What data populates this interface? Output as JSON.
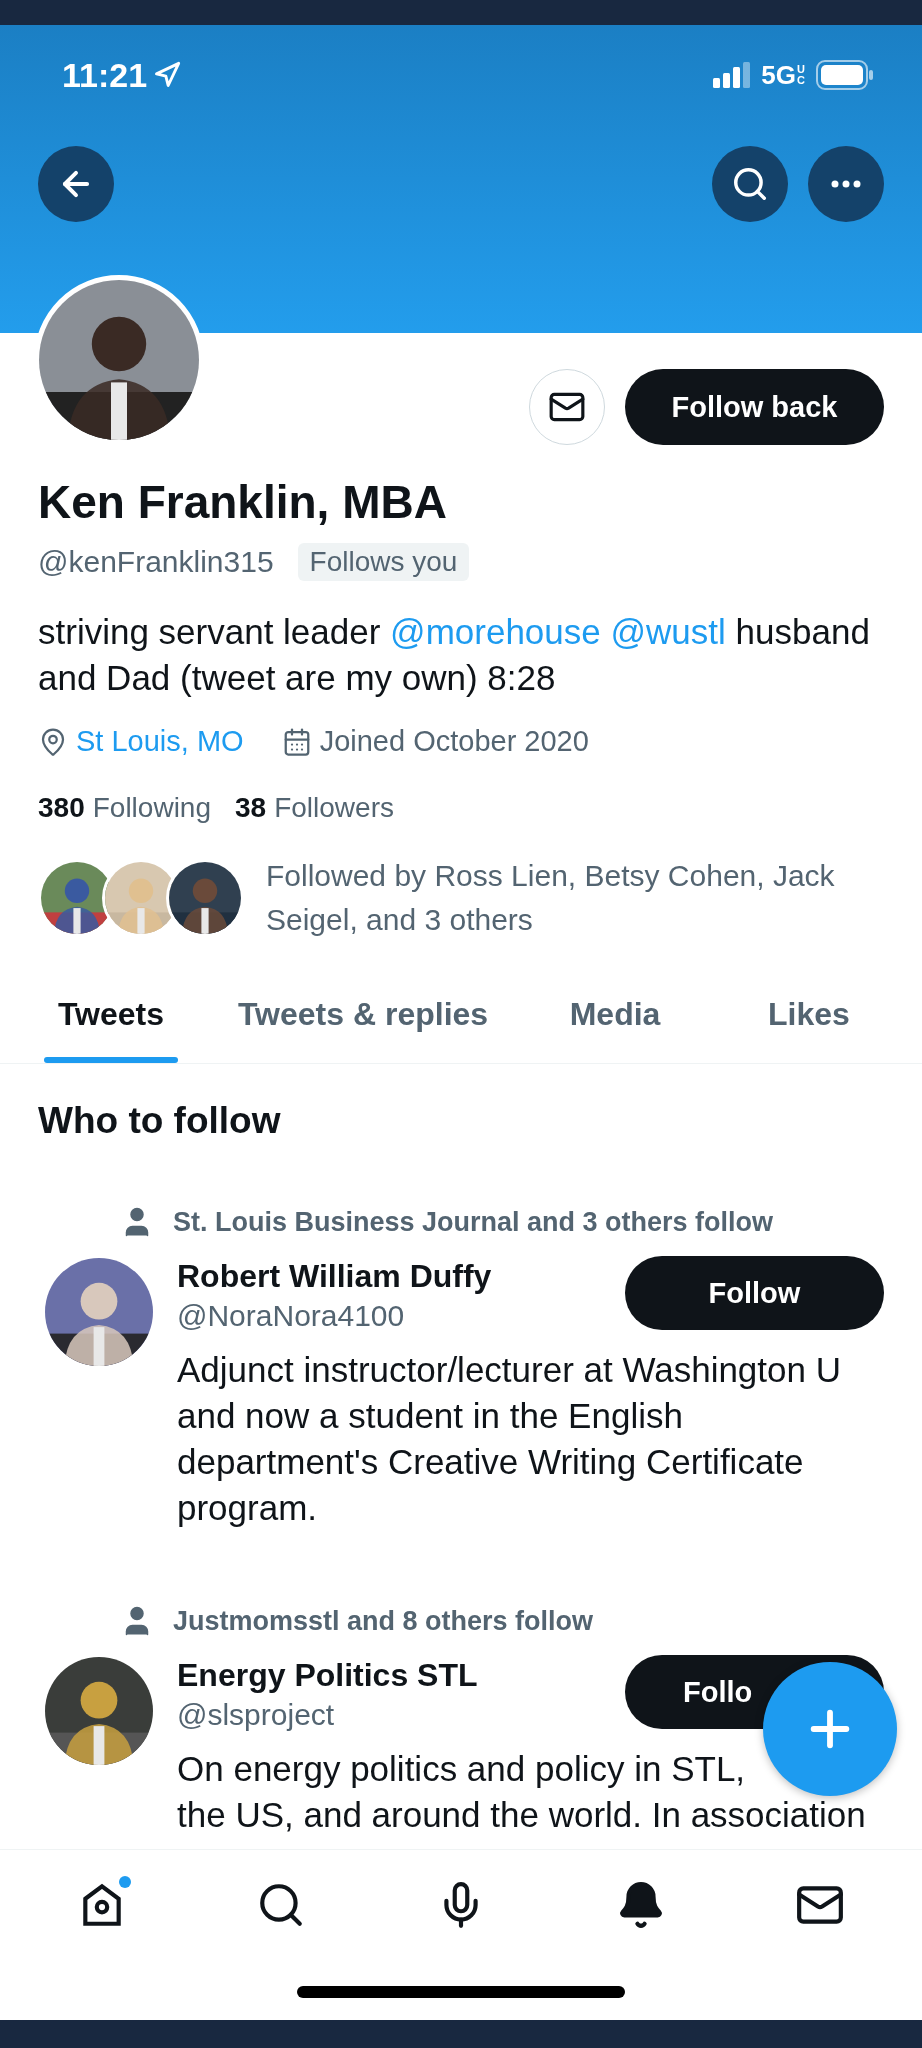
{
  "status_bar": {
    "time": "11:21",
    "network": "5G",
    "network_badge": "UC"
  },
  "profile": {
    "name": "Ken Franklin, MBA",
    "handle": "@kenFranklin315",
    "follows_you": "Follows you",
    "follow_button": "Follow back",
    "bio": [
      {
        "kind": "text",
        "text": "striving servant leader "
      },
      {
        "kind": "link",
        "text": "@morehouse"
      },
      {
        "kind": "link",
        "text": "@wustl"
      },
      {
        "kind": "text",
        "text": " husband and Dad (tweet are my own) 8:28"
      }
    ],
    "location": "St Louis, MO",
    "joined": "Joined October 2020",
    "stats": [
      {
        "count": "380",
        "label": "Following"
      },
      {
        "count": "38",
        "label": "Followers"
      }
    ],
    "followed_by": "Followed by Ross Lien, Betsy Cohen, Jack Seigel, and 3 others"
  },
  "tabs": [
    {
      "label": "Tweets",
      "selected": true
    },
    {
      "label": "Tweets & replies",
      "selected": false
    },
    {
      "label": "Media",
      "selected": false
    },
    {
      "label": "Likes",
      "selected": false
    }
  ],
  "who_to_follow": {
    "title": "Who to follow",
    "suggestions": [
      {
        "context": "St. Louis Business Journal and 3 others follow",
        "name": "Robert William Duffy",
        "handle": "@NoraNora4100",
        "button": "Follow",
        "bio": [
          "Adjunct instructor/lecturer at Washington U and now a student in the English department's Creative Writing Certificate program."
        ]
      },
      {
        "context": "Justmomsstl and 8 others follow",
        "name": "Energy Politics STL",
        "handle": "@slsproject",
        "button": "Follo",
        "bio": [
          "On energy politics and policy in STL,",
          "the US, and around the world. In association"
        ]
      }
    ]
  },
  "bottom_nav": [
    {
      "kind": "home",
      "selected": false,
      "unread": true
    },
    {
      "kind": "search",
      "selected": false
    },
    {
      "kind": "spaces",
      "selected": false
    },
    {
      "kind": "notifications",
      "selected": true
    },
    {
      "kind": "messages",
      "selected": false
    }
  ]
}
